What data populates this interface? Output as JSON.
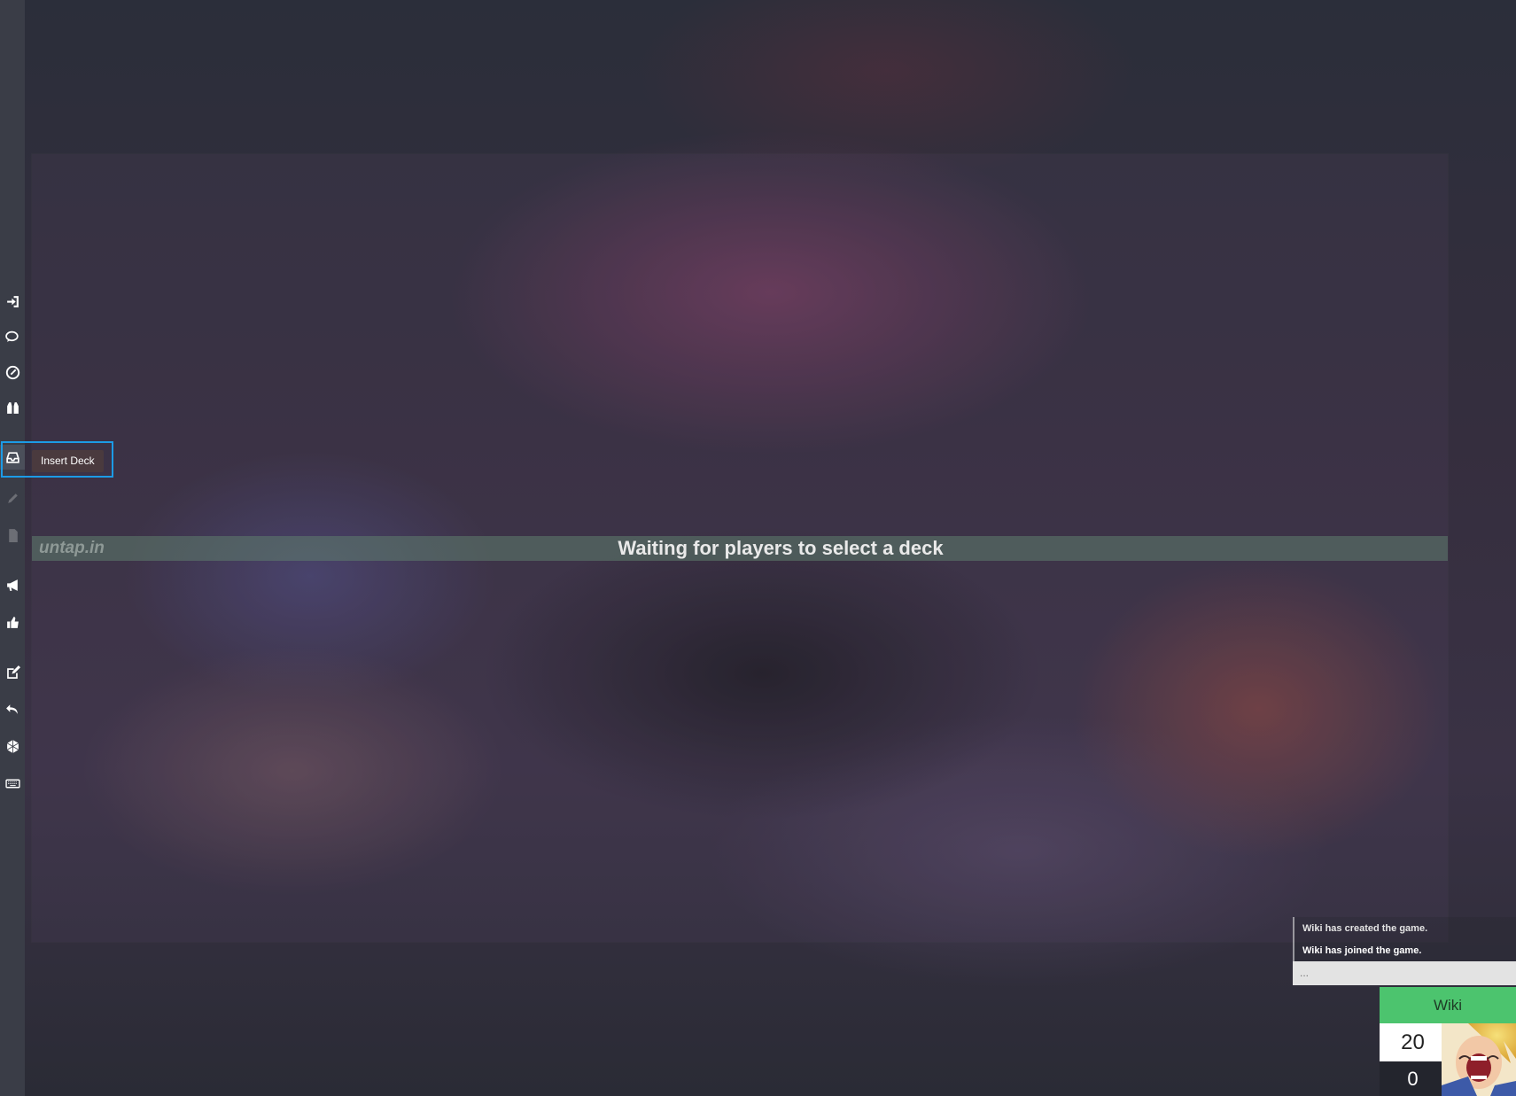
{
  "sidebar": {
    "tools": [
      {
        "name": "leave-game",
        "icon": "sign-in-icon",
        "tooltip": ""
      },
      {
        "name": "chat",
        "icon": "comments-icon",
        "tooltip": ""
      },
      {
        "name": "timer",
        "icon": "clock-icon",
        "tooltip": ""
      },
      {
        "name": "spectate",
        "icon": "binoculars-icon",
        "tooltip": ""
      },
      {
        "name": "insert-deck",
        "icon": "inbox-icon",
        "tooltip": "Insert Deck"
      },
      {
        "name": "edit",
        "icon": "pencil-icon",
        "tooltip": ""
      },
      {
        "name": "sideboard",
        "icon": "file-icon",
        "tooltip": ""
      },
      {
        "name": "announce",
        "icon": "bullhorn-icon",
        "tooltip": ""
      },
      {
        "name": "like",
        "icon": "thumbs-up-icon",
        "tooltip": ""
      },
      {
        "name": "notes",
        "icon": "edit-icon",
        "tooltip": ""
      },
      {
        "name": "undo",
        "icon": "undo-icon",
        "tooltip": ""
      },
      {
        "name": "dice",
        "icon": "dice-icon",
        "tooltip": ""
      },
      {
        "name": "shortcuts",
        "icon": "keyboard-icon",
        "tooltip": ""
      }
    ]
  },
  "tooltip": {
    "text": "Insert Deck"
  },
  "banner": {
    "logo": "untap.in",
    "status": "Waiting for players to select a deck"
  },
  "chat": {
    "messages": [
      "Wiki has created the game.",
      "Wiki has joined the game."
    ],
    "input_placeholder": "..."
  },
  "player": {
    "name": "Wiki",
    "life": "20",
    "poison": "0",
    "name_color": "#4cc46e"
  },
  "colors": {
    "accent_highlight": "#1c9be6"
  }
}
